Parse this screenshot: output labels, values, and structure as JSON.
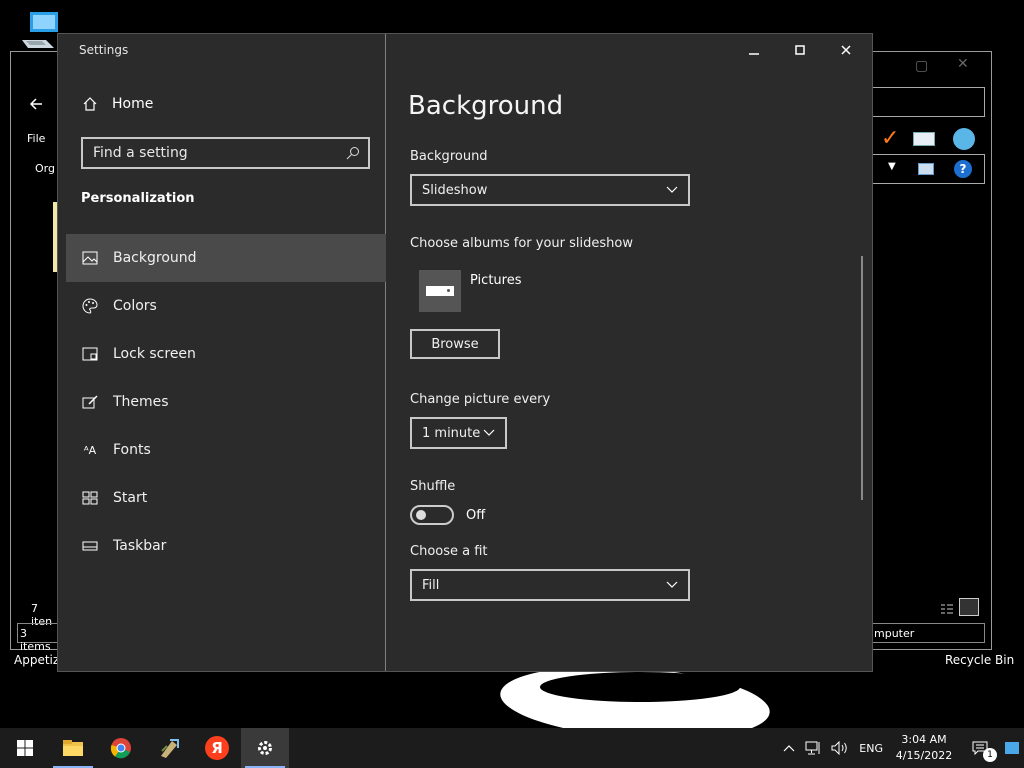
{
  "desktop": {
    "icons": [
      {
        "label": "Appetize"
      },
      {
        "label": "Recycle Bin"
      }
    ],
    "bg_left_window": {
      "menu_file": "File",
      "org": "Org",
      "items7": "7 iten",
      "items3": "3 items"
    },
    "bg_right_window": {
      "status": "mputer"
    }
  },
  "settings": {
    "window_title": "Settings",
    "home_label": "Home",
    "search_placeholder": "Find a setting",
    "section": "Personalization",
    "nav": [
      {
        "label": "Background",
        "icon": "image-icon",
        "active": true
      },
      {
        "label": "Colors",
        "icon": "palette-icon",
        "active": false
      },
      {
        "label": "Lock screen",
        "icon": "lock-screen-icon",
        "active": false
      },
      {
        "label": "Themes",
        "icon": "brush-icon",
        "active": false
      },
      {
        "label": "Fonts",
        "icon": "font-icon",
        "active": false
      },
      {
        "label": "Start",
        "icon": "start-icon",
        "active": false
      },
      {
        "label": "Taskbar",
        "icon": "taskbar-icon",
        "active": false
      }
    ],
    "page_title": "Background",
    "background_label": "Background",
    "background_value": "Slideshow",
    "albums_label": "Choose albums for your slideshow",
    "album_name": "Pictures",
    "browse_label": "Browse",
    "change_every_label": "Change picture every",
    "change_every_value": "1 minute",
    "shuffle_label": "Shuffle",
    "shuffle_state": "Off",
    "fit_label": "Choose a fit",
    "fit_value": "Fill"
  },
  "taskbar": {
    "apps": [
      {
        "name": "start-button"
      },
      {
        "name": "file-explorer-icon"
      },
      {
        "name": "chrome-icon"
      },
      {
        "name": "app-icon"
      },
      {
        "name": "yandex-icon"
      },
      {
        "name": "settings-gear-icon"
      }
    ],
    "yandex_letter": "Я",
    "language": "ENG",
    "time": "3:04 AM",
    "date": "4/15/2022",
    "notifications": "1"
  }
}
